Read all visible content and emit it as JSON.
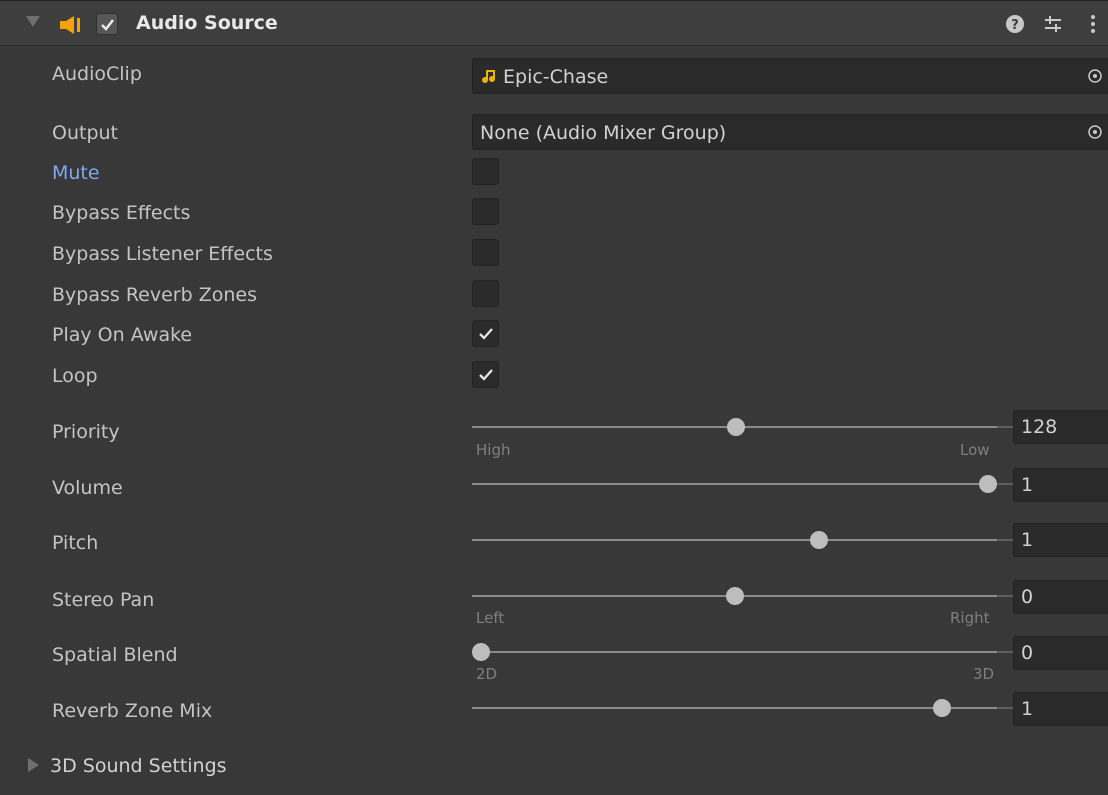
{
  "component": {
    "title": "Audio Source",
    "enabled": true,
    "icons": [
      "speaker-icon",
      "help-icon",
      "presets-icon",
      "kebab-menu-icon"
    ]
  },
  "fields": {
    "audio_clip": {
      "label": "AudioClip",
      "value": "Epic-Chase",
      "icon": "music-note-icon"
    },
    "output": {
      "label": "Output",
      "value": "None (Audio Mixer Group)"
    }
  },
  "toggles": [
    {
      "label": "Mute",
      "checked": false,
      "highlighted": true
    },
    {
      "label": "Bypass Effects",
      "checked": false
    },
    {
      "label": "Bypass Listener Effects",
      "checked": false
    },
    {
      "label": "Bypass Reverb Zones",
      "checked": false
    },
    {
      "label": "Play On Awake",
      "checked": true
    },
    {
      "label": "Loop",
      "checked": true
    }
  ],
  "sliders": {
    "priority": {
      "label": "Priority",
      "value": "128",
      "fraction": 0.502,
      "min_label": "High",
      "max_label": "Low"
    },
    "volume": {
      "label": "Volume",
      "value": "1",
      "fraction": 1.0
    },
    "pitch": {
      "label": "Pitch",
      "value": "1",
      "fraction": 0.667
    },
    "stereo_pan": {
      "label": "Stereo Pan",
      "value": "0",
      "fraction": 0.5,
      "min_label": "Left",
      "max_label": "Right"
    },
    "spatial_blend": {
      "label": "Spatial Blend",
      "value": "0",
      "fraction": 0.0,
      "min_label": "2D",
      "max_label": "3D"
    },
    "reverb_zone_mix": {
      "label": "Reverb Zone Mix",
      "value": "1",
      "fraction": 0.909
    }
  },
  "foldout": {
    "label": "3D Sound Settings",
    "expanded": false
  },
  "colors": {
    "background": "#383838",
    "header": "#3e3e3e",
    "field": "#2a2a2a",
    "accent_label": "#7fa8f0",
    "clip_icon": "#f0b400",
    "speaker": "#f5a300"
  }
}
